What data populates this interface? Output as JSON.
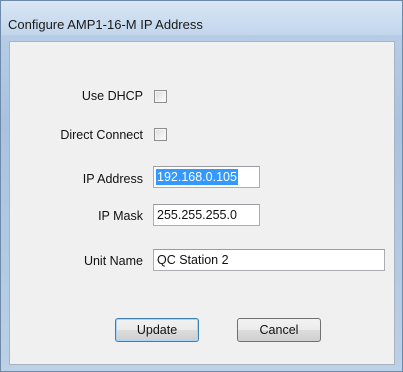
{
  "window": {
    "title": "Configure AMP1-16-M IP Address"
  },
  "form": {
    "use_dhcp": {
      "label": "Use DHCP",
      "checked": false
    },
    "direct_connect": {
      "label": "Direct Connect",
      "checked": false
    },
    "ip_address": {
      "label": "IP Address",
      "value": "192.168.0.105"
    },
    "ip_mask": {
      "label": "IP Mask",
      "value": "255.255.255.0"
    },
    "unit_name": {
      "label": "Unit Name",
      "value": "QC Station 2"
    }
  },
  "buttons": {
    "update_label": "Update",
    "cancel_label": "Cancel"
  },
  "colors": {
    "selection": "#3399ff",
    "client_background": "#f0f0f0",
    "title_gradient_top": "#d8e6f4"
  }
}
